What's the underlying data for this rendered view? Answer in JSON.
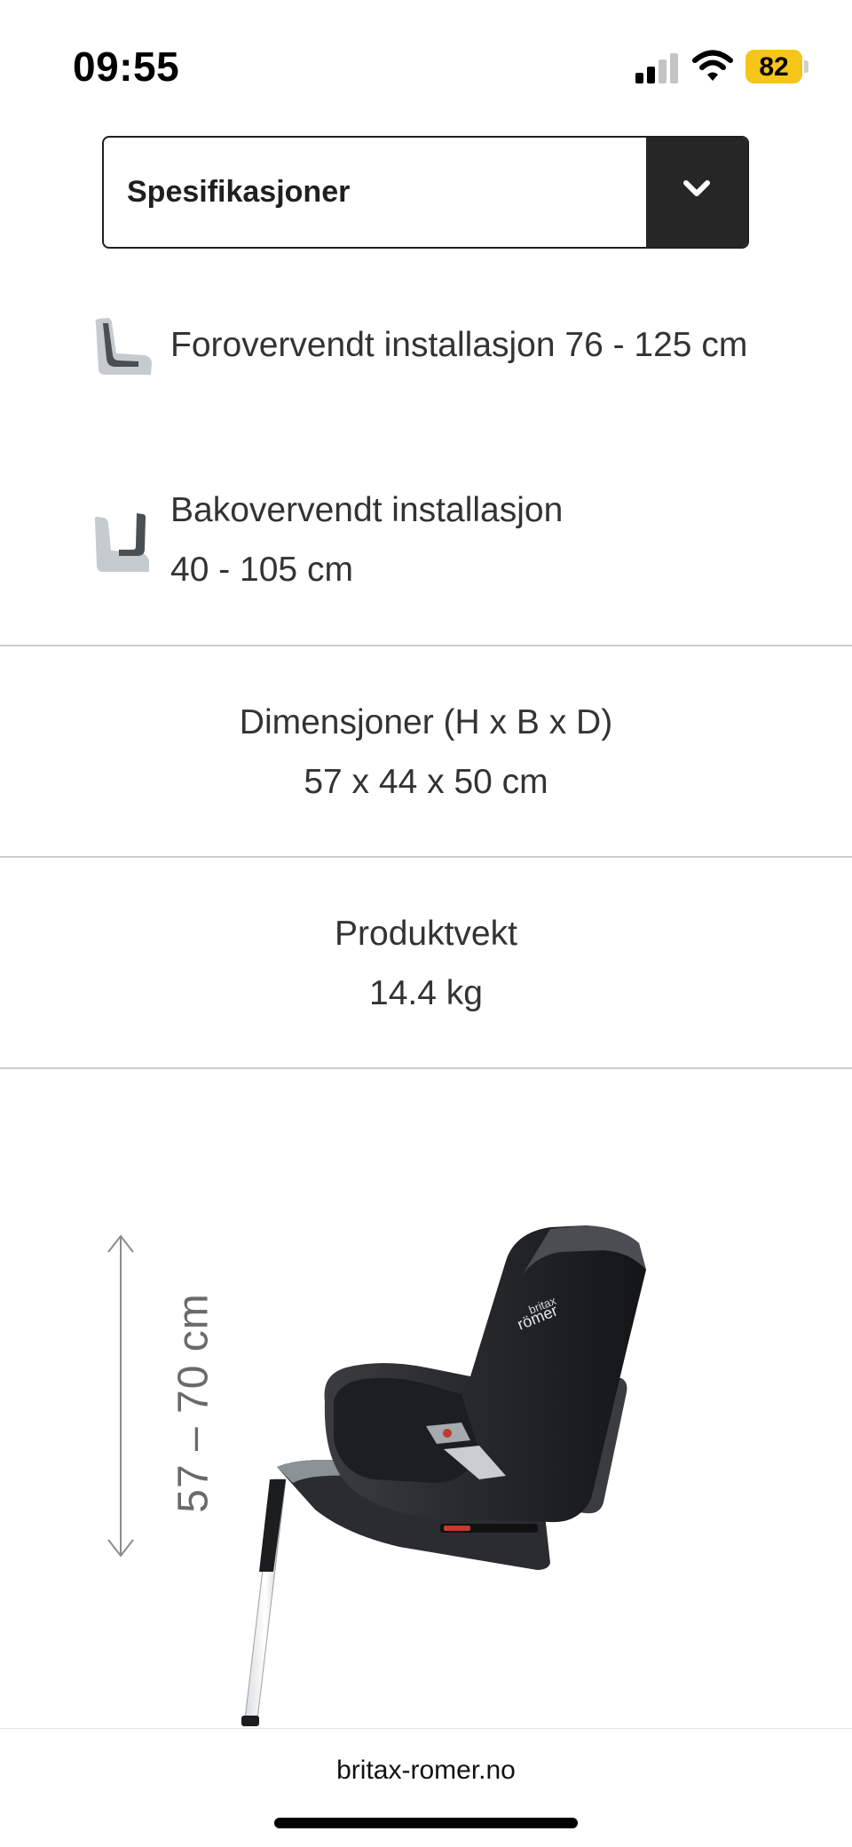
{
  "status_bar": {
    "time": "09:55",
    "battery": "82",
    "icons": [
      "signal-icon",
      "wifi-icon",
      "battery-icon"
    ]
  },
  "dropdown": {
    "selected": "Spesifikasjoner"
  },
  "specs": {
    "forward": {
      "text": "Forovervendt installasjon 76 - 125 cm",
      "icon": "forward-facing-seat-icon"
    },
    "rear": {
      "line1": "Bakovervendt installasjon",
      "line2": "40 - 105 cm",
      "icon": "rear-facing-seat-icon"
    }
  },
  "dimensions": {
    "label": "Dimensjoner (H x B x D)",
    "value": "57 x 44 x 50 cm"
  },
  "weight": {
    "label": "Produktvekt",
    "value": "14.4 kg"
  },
  "illustration": {
    "height_range": "57 – 70 cm",
    "brand_mark_line1": "britax",
    "brand_mark_line2": "römer"
  },
  "browser": {
    "url": "britax-romer.no"
  },
  "colors": {
    "battery": "#f5c518",
    "toggle_bg": "#262626",
    "divider": "#c9ced1",
    "icon_grey": "#b9c0c4"
  }
}
